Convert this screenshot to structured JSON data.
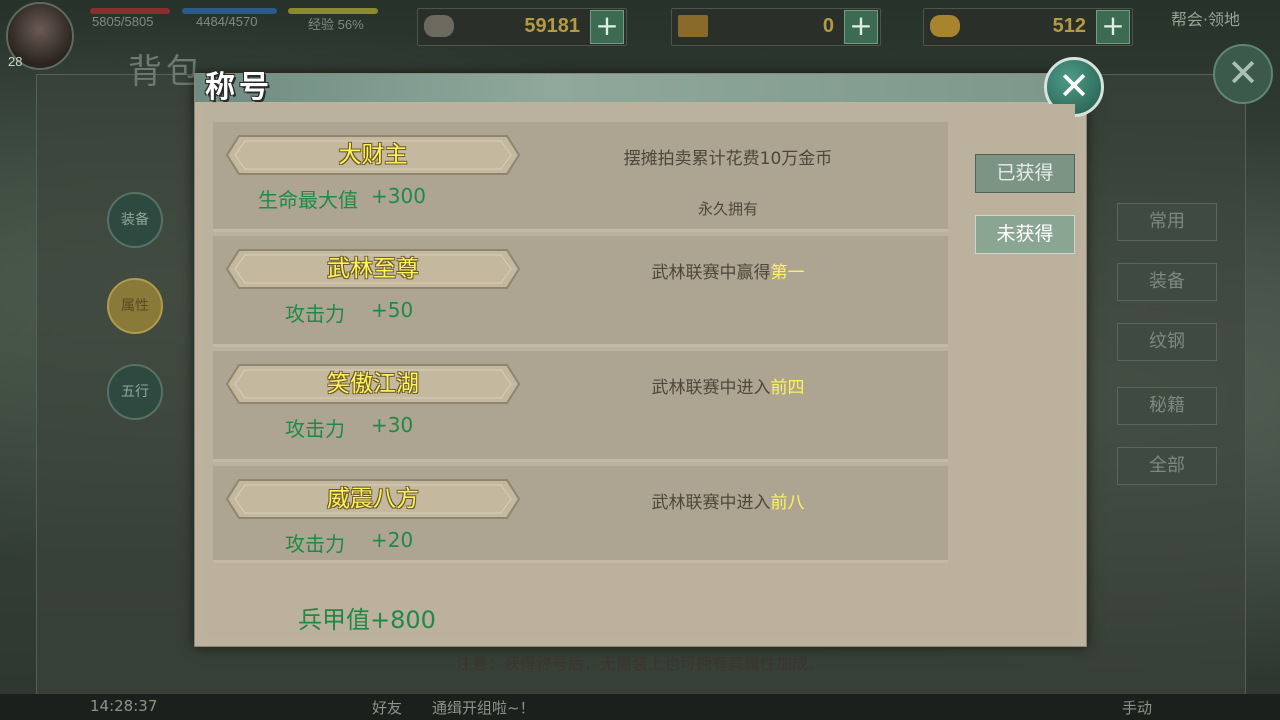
{
  "hud": {
    "level": "28",
    "hp_text": "5805/5805",
    "mp_text": "4484/4570",
    "exp_text": "经验 56%",
    "silver": "59181",
    "ticket": "0",
    "gold": "512",
    "top_right": "帮会·领地",
    "plus": "+"
  },
  "background": {
    "bag_title": "背包",
    "orb_equip": "装备",
    "orb_attr": "属性",
    "orb_five": "五行",
    "side_tabs": [
      "常用",
      "装备",
      "纹钢",
      "秘籍",
      "全部"
    ],
    "bottom_time": "14:28:37",
    "bottom_friend": "好友",
    "bottom_msg": "通缉开组啦~！",
    "bottom_auto": "手动"
  },
  "dialog": {
    "title": "称号",
    "close_symbol": "✕",
    "filters": {
      "owned": "已获得",
      "not_owned": "未获得"
    },
    "titles": [
      {
        "name": "大财主",
        "attr_name": "生命最大值",
        "attr_value": "+300",
        "cond_prefix": "摆摊拍卖累计花费10万金币",
        "cond_highlight": "",
        "duration": "永久拥有"
      },
      {
        "name": "武林至尊",
        "attr_name": "攻击力",
        "attr_value": "+50",
        "cond_prefix": "武林联赛中赢得",
        "cond_highlight": "第一",
        "duration": ""
      },
      {
        "name": "笑傲江湖",
        "attr_name": "攻击力",
        "attr_value": "+30",
        "cond_prefix": "武林联赛中进入",
        "cond_highlight": "前四",
        "duration": ""
      },
      {
        "name": "威震八方",
        "attr_name": "攻击力",
        "attr_value": "+20",
        "cond_prefix": "武林联赛中进入",
        "cond_highlight": "前八",
        "duration": ""
      }
    ],
    "total_armor": "兵甲值+800",
    "note": "注意：获得称号后，无需装上也可拥有其属性加成。"
  },
  "colors": {
    "title_name": "#fff25a",
    "attr_green": "#1f8a46",
    "highlight_yellow": "#fff35c",
    "panel_beige": "#bdb29e",
    "accent_teal": "#2e6a5a"
  }
}
